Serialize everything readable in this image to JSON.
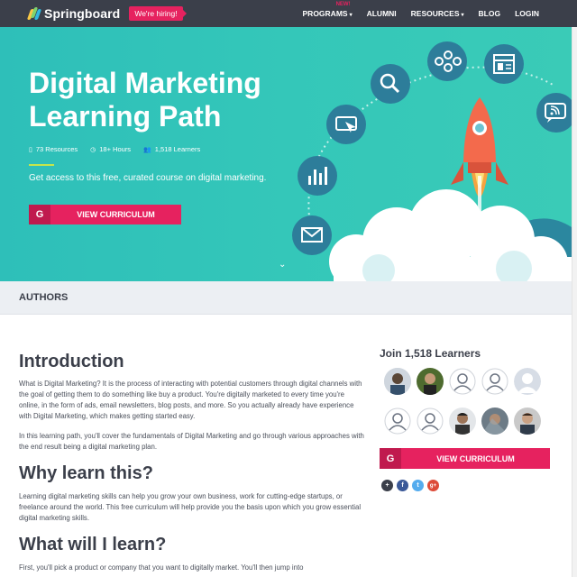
{
  "nav": {
    "logo_text": "Springboard",
    "hiring_label": "We're hiring!",
    "links": [
      {
        "label": "PROGRAMS",
        "badge": "NEW!",
        "has_caret": true
      },
      {
        "label": "ALUMNI"
      },
      {
        "label": "RESOURCES",
        "has_caret": true
      },
      {
        "label": "BLOG"
      },
      {
        "label": "LOGIN"
      }
    ]
  },
  "hero": {
    "title_line1": "Digital Marketing",
    "title_line2": "Learning Path",
    "resources": "73 Resources",
    "hours": "18+ Hours",
    "learners": "1,518 Learners",
    "subtitle": "Get access to this free, curated course on digital marketing.",
    "cta_icon": "G",
    "cta_label": "VIEW CURRICULUM"
  },
  "authors": {
    "label": "AUTHORS"
  },
  "sections": [
    {
      "heading": "Introduction",
      "paragraphs": [
        "What is Digital Marketing? It is the process of interacting with potential customers through digital channels with the goal of getting them to do something like buy a product. You're digitally marketed to every time you're online, in the form of ads, email newsletters, blog posts, and more. So you actually already have experience with Digital Marketing, which makes getting started easy.",
        "In this learning path, you'll cover the fundamentals of Digital Marketing and go through various approaches with the end result being a digital marketing plan."
      ]
    },
    {
      "heading": "Why learn this?",
      "paragraphs": [
        "Learning digital marketing skills can help you grow your own business, work for cutting-edge startups, or freelance around the world. This free curriculum will help provide you the basis upon which you grow essential digital marketing skills."
      ]
    },
    {
      "heading": "What will I learn?",
      "paragraphs": [
        "First, you'll pick a product or company that you want to digitally market. You'll then jump into"
      ]
    }
  ],
  "sidebar": {
    "join_title": "Join 1,518 Learners",
    "cta_icon": "G",
    "cta_label": "VIEW CURRICULUM",
    "shares": [
      "+",
      "f",
      "t",
      "g+"
    ]
  },
  "colors": {
    "nav_bg": "#3b3f4a",
    "hero_bg": "#34c7b9",
    "accent": "#e6225f",
    "rule": "#c6e64a"
  },
  "icons": [
    "search-icon",
    "network-icon",
    "layout-icon",
    "rss-chat-icon",
    "cursor-icon",
    "bar-chart-icon",
    "mail-icon",
    "rocket-icon"
  ]
}
